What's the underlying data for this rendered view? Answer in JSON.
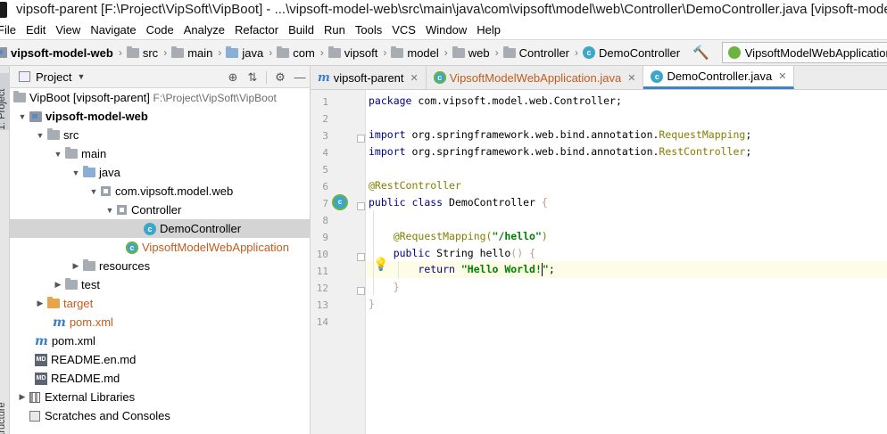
{
  "window": {
    "title": "vipsoft-parent [F:\\Project\\VipSoft\\VipBoot] - ...\\vipsoft-model-web\\src\\main\\java\\com\\vipsoft\\model\\web\\Controller\\DemoController.java [vipsoft-model-web] - IntelliJ IDEA"
  },
  "menu": [
    "File",
    "Edit",
    "View",
    "Navigate",
    "Code",
    "Analyze",
    "Refactor",
    "Build",
    "Run",
    "Tools",
    "VCS",
    "Window",
    "Help"
  ],
  "breadcrumbs": [
    "vipsoft-model-web",
    "src",
    "main",
    "java",
    "com",
    "vipsoft",
    "model",
    "web",
    "Controller",
    "DemoController"
  ],
  "run_config": "VipsoftModelWebApplication",
  "toolstrip": {
    "project": "1: Project",
    "structure": "Structure"
  },
  "project_panel": {
    "title": "Project",
    "tree": [
      {
        "label": "VipBoot [vipsoft-parent]",
        "path": "F:\\Project\\VipSoft\\VipBoot"
      },
      {
        "label": "vipsoft-model-web"
      },
      {
        "label": "src"
      },
      {
        "label": "main"
      },
      {
        "label": "java"
      },
      {
        "label": "com.vipsoft.model.web"
      },
      {
        "label": "Controller"
      },
      {
        "label": "DemoController"
      },
      {
        "label": "VipsoftModelWebApplication"
      },
      {
        "label": "resources"
      },
      {
        "label": "test"
      },
      {
        "label": "target"
      },
      {
        "label": "pom.xml"
      },
      {
        "label": "pom.xml"
      },
      {
        "label": "README.en.md"
      },
      {
        "label": "README.md"
      },
      {
        "label": "External Libraries"
      },
      {
        "label": "Scratches and Consoles"
      }
    ]
  },
  "tabs": [
    {
      "label": "vipsoft-parent",
      "active": false
    },
    {
      "label": "VipsoftModelWebApplication.java",
      "active": false
    },
    {
      "label": "DemoController.java",
      "active": true
    }
  ],
  "code": {
    "line_numbers": [
      "1",
      "2",
      "3",
      "4",
      "5",
      "6",
      "7",
      "8",
      "9",
      "10",
      "11",
      "12",
      "13",
      "14"
    ],
    "l1_kw": "package",
    "l1_rest": " com.vipsoft.model.web.Controller;",
    "l3_kw": "import",
    "l3_pkg": " org.springframework.web.bind.annotation.",
    "l3_cls": "RequestMapping",
    "l3_end": ";",
    "l4_kw": "import",
    "l4_pkg": " org.springframework.web.bind.annotation.",
    "l4_cls": "RestController",
    "l4_end": ";",
    "l6_ann": "@RestController",
    "l7_kw1": "public",
    "l7_kw2": "class",
    "l7_name": " DemoController ",
    "l7_brace": "{",
    "l9_ann": "@RequestMapping(",
    "l9_str": "\"/hello\"",
    "l9_end": ")",
    "l10_kw": "public",
    "l10_rest": " String hello",
    "l10_paren": "()",
    "l10_brace": "{",
    "l11_kw": "return",
    "l11_str1": "\"Hello World!",
    "l11_str2": "\"",
    "l11_end": ";",
    "l12_brace": "}",
    "l13_brace": "}"
  }
}
